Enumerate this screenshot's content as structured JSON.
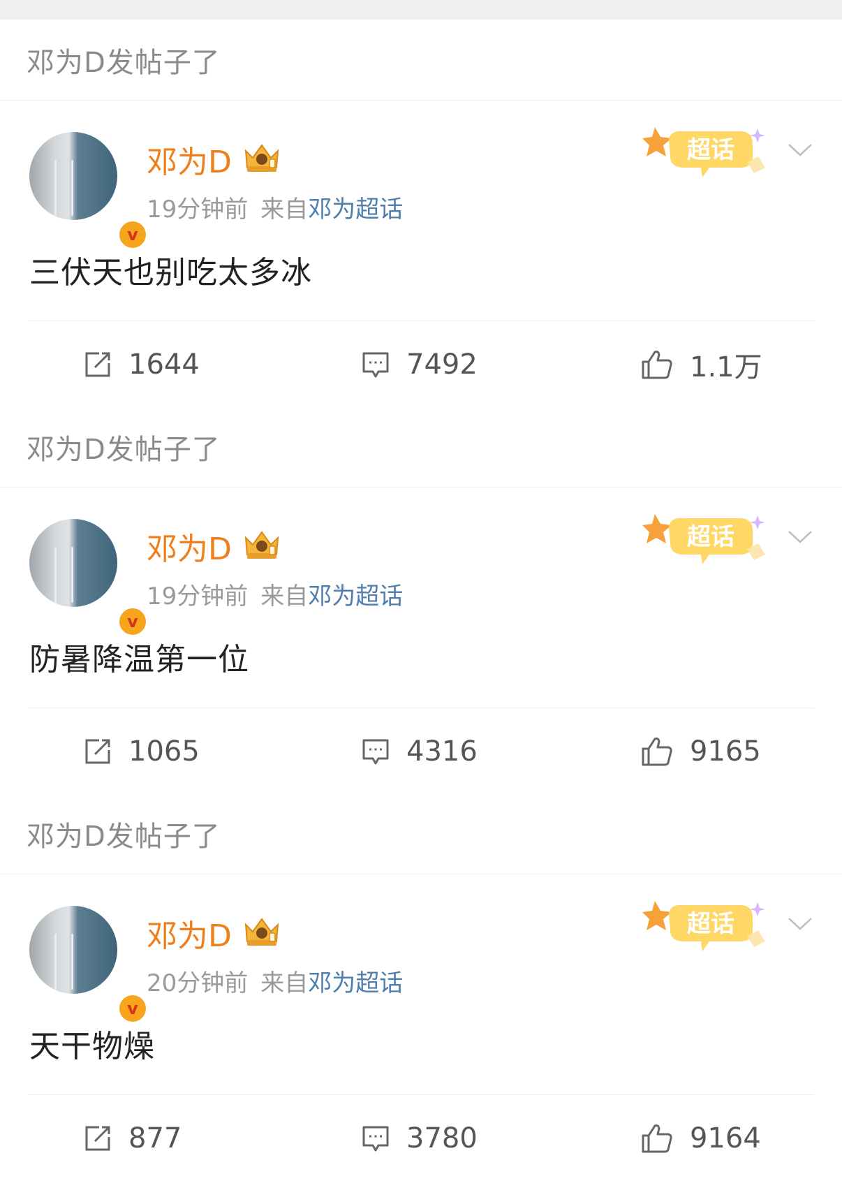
{
  "posts": [
    {
      "header": "邓为D发帖子了",
      "author": "邓为D",
      "time": "19分钟前",
      "source_prefix": "来自",
      "source_topic": "邓为超话",
      "text": "三伏天也别吃太多冰",
      "reposts": "1644",
      "comments": "7492",
      "likes": "1.1万"
    },
    {
      "header": "邓为D发帖子了",
      "author": "邓为D",
      "time": "19分钟前",
      "source_prefix": "来自",
      "source_topic": "邓为超话",
      "text": "防暑降温第一位",
      "reposts": "1065",
      "comments": "4316",
      "likes": "9165"
    },
    {
      "header": "邓为D发帖子了",
      "author": "邓为D",
      "time": "20分钟前",
      "source_prefix": "来自",
      "source_topic": "邓为超话",
      "text": "天干物燥",
      "reposts": "877",
      "comments": "3780",
      "likes": "9164"
    }
  ],
  "badge_label": "超话",
  "colors": {
    "author": "#f07e1b",
    "topic": "#4f7dae",
    "meta": "#9a9a9a"
  },
  "icons": [
    "verified-icon",
    "crown-icon",
    "chaohua-badge",
    "chevron-down-icon",
    "repost-icon",
    "comment-icon",
    "like-icon"
  ]
}
